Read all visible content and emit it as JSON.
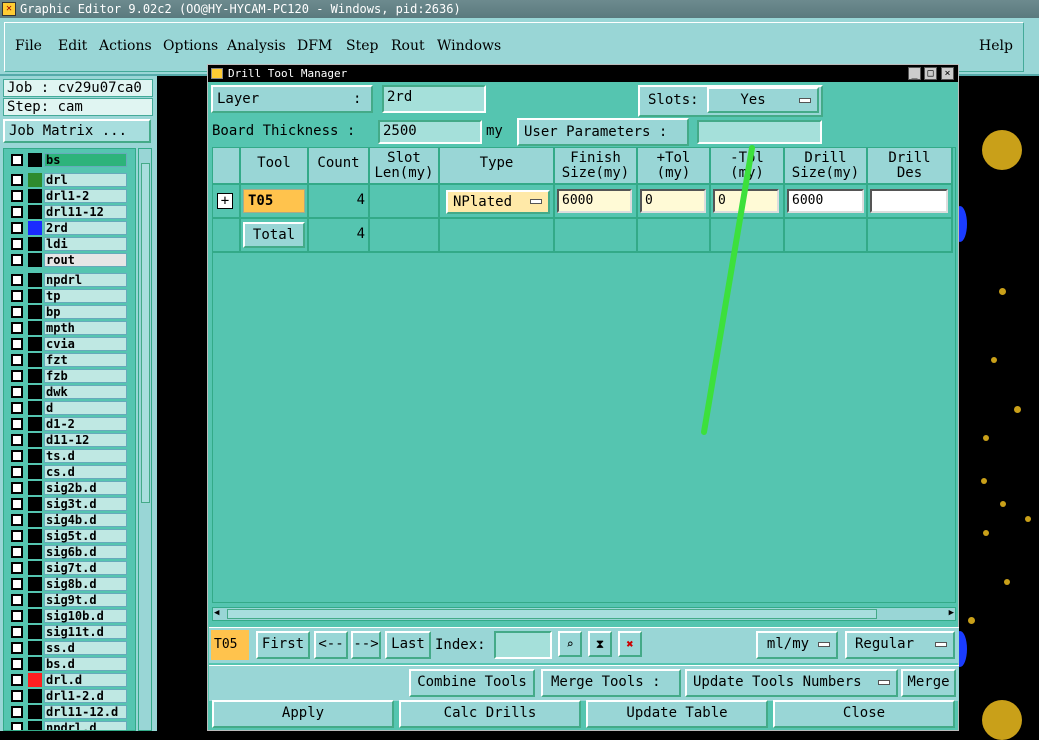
{
  "window": {
    "title": "Graphic Editor 9.02c2 (OO@HY-HYCAM-PC120 - Windows, pid:2636)"
  },
  "menu": {
    "file": "File",
    "edit": "Edit",
    "actions": "Actions",
    "options": "Options",
    "analysis": "Analysis",
    "dfm": "DFM",
    "step": "Step",
    "rout": "Rout",
    "windows": "Windows",
    "help": "Help"
  },
  "left": {
    "job": "Job : cv29u07ca0",
    "step": "Step: cam",
    "job_matrix": "Job Matrix ...",
    "layers": [
      "bs",
      "drl",
      "drl1-2",
      "drl11-12",
      "2rd",
      "ldi",
      "rout",
      "npdrl",
      "tp",
      "bp",
      "mpth",
      "cvia",
      "fzt",
      "fzb",
      "dwk",
      "d",
      "d1-2",
      "d11-12",
      "ts.d",
      "cs.d",
      "sig2b.d",
      "sig3t.d",
      "sig4b.d",
      "sig5t.d",
      "sig6b.d",
      "sig7t.d",
      "sig8b.d",
      "sig9t.d",
      "sig10b.d",
      "sig11t.d",
      "ss.d",
      "bs.d",
      "drl.d",
      "drl1-2.d",
      "drl11-12.d",
      "npdrl.d"
    ]
  },
  "dialog": {
    "title": "Drill Tool Manager",
    "layer_label": "Layer",
    "layer_colon": ":",
    "layer_value": "2rd",
    "slots_label": "Slots:",
    "slots_value": "Yes",
    "board_thickness_label": "Board Thickness :",
    "board_thickness_value": "2500",
    "board_thickness_unit": "my",
    "user_params_label": "User Parameters :",
    "user_params_value": "",
    "columns": {
      "tool": "Tool",
      "count": "Count",
      "slot_len_1": "Slot",
      "slot_len_2": "Len(my)",
      "type": "Type",
      "finish_1": "Finish",
      "finish_2": "Size(my)",
      "ptol_1": "+Tol",
      "ptol_2": "(my)",
      "mtol_1": "-Tol",
      "mtol_2": "(my)",
      "drill_1": "Drill",
      "drill_2": "Size(my)",
      "des_1": "Drill",
      "des_2": "Des"
    },
    "row": {
      "tool": "T05",
      "count": "4",
      "type": "NPlated",
      "finish_size": "6000",
      "plus_tol": "0",
      "minus_tol": "0",
      "drill_size": "6000",
      "drill_des": ""
    },
    "total": {
      "label": "Total",
      "count": "4"
    },
    "nav": {
      "current_tool": "T05",
      "first": "First",
      "prev": "<--",
      "next": "-->",
      "last": "Last",
      "index_label": "Index:",
      "index_value": "",
      "units": "ml/my",
      "mode": "Regular"
    },
    "actions": {
      "combine": "Combine Tools",
      "merge_label": "Merge Tools :",
      "merge_option": "Update Tools Numbers",
      "merge": "Merge",
      "apply": "Apply",
      "calc": "Calc Drills",
      "update": "Update Table",
      "close": "Close"
    }
  }
}
